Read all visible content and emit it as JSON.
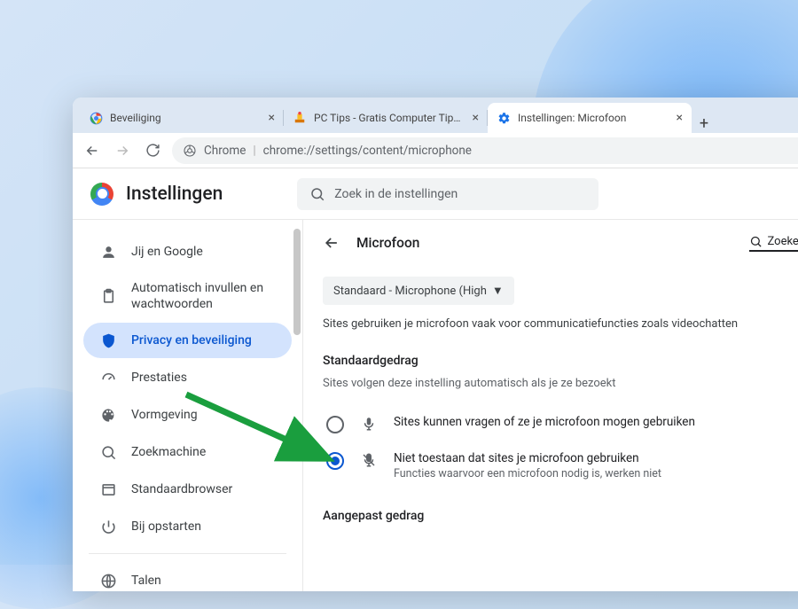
{
  "tabs": [
    {
      "title": "Beveiliging",
      "favicon": "google"
    },
    {
      "title": "PC Tips - Gratis Computer Tips, in",
      "favicon": "pctips"
    },
    {
      "title": "Instellingen: Microfoon",
      "favicon": "gear",
      "active": true
    }
  ],
  "toolbar": {
    "chrome_label": "Chrome",
    "url": "chrome://settings/content/microphone"
  },
  "header": {
    "title": "Instellingen",
    "search_placeholder": "Zoek in de instellingen"
  },
  "sidebar": {
    "items": [
      {
        "label": "Jij en Google",
        "icon": "person"
      },
      {
        "label": "Automatisch invullen en wachtwoorden",
        "icon": "clipboard"
      },
      {
        "label": "Privacy en beveiliging",
        "icon": "shield",
        "selected": true
      },
      {
        "label": "Prestaties",
        "icon": "speedometer"
      },
      {
        "label": "Vormgeving",
        "icon": "palette"
      },
      {
        "label": "Zoekmachine",
        "icon": "search"
      },
      {
        "label": "Standaardbrowser",
        "icon": "window"
      },
      {
        "label": "Bij opstarten",
        "icon": "power"
      }
    ],
    "lower": [
      {
        "label": "Talen",
        "icon": "globe"
      }
    ]
  },
  "content": {
    "page_title": "Microfoon",
    "search_label": "Zoeken",
    "device_select": "Standaard - Microphone (High",
    "intro": "Sites gebruiken je microfoon vaak voor communicatiefuncties zoals videochatten",
    "section1_heading": "Standaardgedrag",
    "section1_sub": "Sites volgen deze instelling automatisch als je ze bezoekt",
    "radio_allow": "Sites kunnen vragen of ze je microfoon mogen gebruiken",
    "radio_block": "Niet toestaan dat sites je microfoon gebruiken",
    "radio_block_sub": "Functies waarvoor een microfoon nodig is, werken niet",
    "section2_heading": "Aangepast gedrag"
  }
}
